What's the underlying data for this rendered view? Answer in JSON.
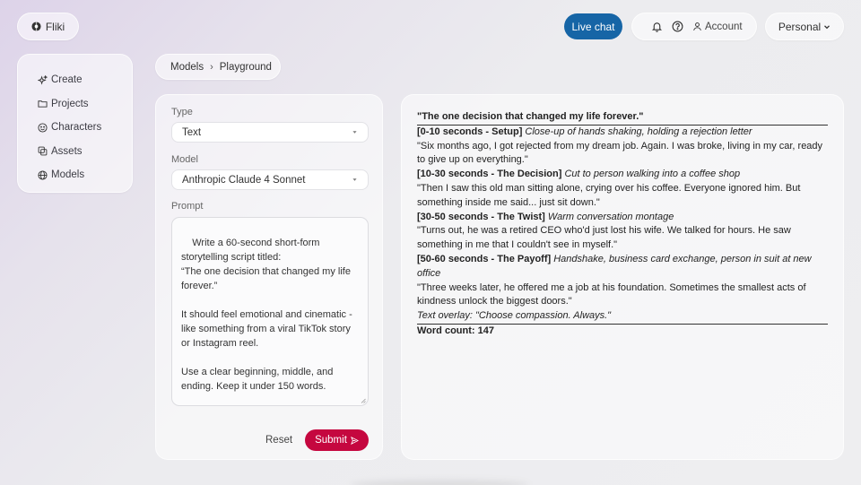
{
  "header": {
    "logo_label": "Fliki",
    "live_chat_label": "Live chat",
    "account_label": "Account",
    "workspace_label": "Personal"
  },
  "sidebar": {
    "items": [
      {
        "label": "Create",
        "icon": "sparkle-icon"
      },
      {
        "label": "Projects",
        "icon": "folder-icon"
      },
      {
        "label": "Characters",
        "icon": "smiley-icon"
      },
      {
        "label": "Assets",
        "icon": "assets-icon"
      },
      {
        "label": "Models",
        "icon": "globe-icon"
      }
    ]
  },
  "breadcrumb": {
    "parent": "Models",
    "separator": "›",
    "current": "Playground"
  },
  "form": {
    "type_label": "Type",
    "type_value": "Text",
    "model_label": "Model",
    "model_value": "Anthropic Claude 4 Sonnet",
    "prompt_label": "Prompt",
    "prompt_value": "Write a 60-second short-form storytelling script titled:\n“The one decision that changed my life forever.”\n\nIt should feel emotional and cinematic - like something from a viral TikTok story or Instagram reel.\n\nUse a clear beginning, middle, and ending. Keep it under 150 words.",
    "reset_label": "Reset",
    "submit_label": "Submit"
  },
  "output": {
    "title": "\"The one decision that changed my life forever.\"",
    "sections": [
      {
        "heading": "[0-10 seconds - Setup]",
        "direction": "Close-up of hands shaking, holding a rejection letter",
        "line": "\"Six months ago, I got rejected from my dream job. Again. I was broke, living in my car, ready to give up on everything.\""
      },
      {
        "heading": "[10-30 seconds - The Decision]",
        "direction": "Cut to person walking into a coffee shop",
        "line": "\"Then I saw this old man sitting alone, crying over his coffee. Everyone ignored him. But something inside me said... just sit down.\""
      },
      {
        "heading": "[30-50 seconds - The Twist]",
        "direction": "Warm conversation montage",
        "line": "\"Turns out, he was a retired CEO who'd just lost his wife. We talked for hours. He saw something in me that I couldn't see in myself.\""
      },
      {
        "heading": "[50-60 seconds - The Payoff]",
        "direction": "Handshake, business card exchange, person in suit at new office",
        "line": "\"Three weeks later, he offered me a job at his foundation. Sometimes the smallest acts of kindness unlock the biggest doors.\""
      }
    ],
    "overlay": "Text overlay: \"Choose compassion. Always.\"",
    "word_count": "Word count: 147"
  },
  "colors": {
    "accent_blue": "#1665a6",
    "submit_red": "#c5073f"
  }
}
